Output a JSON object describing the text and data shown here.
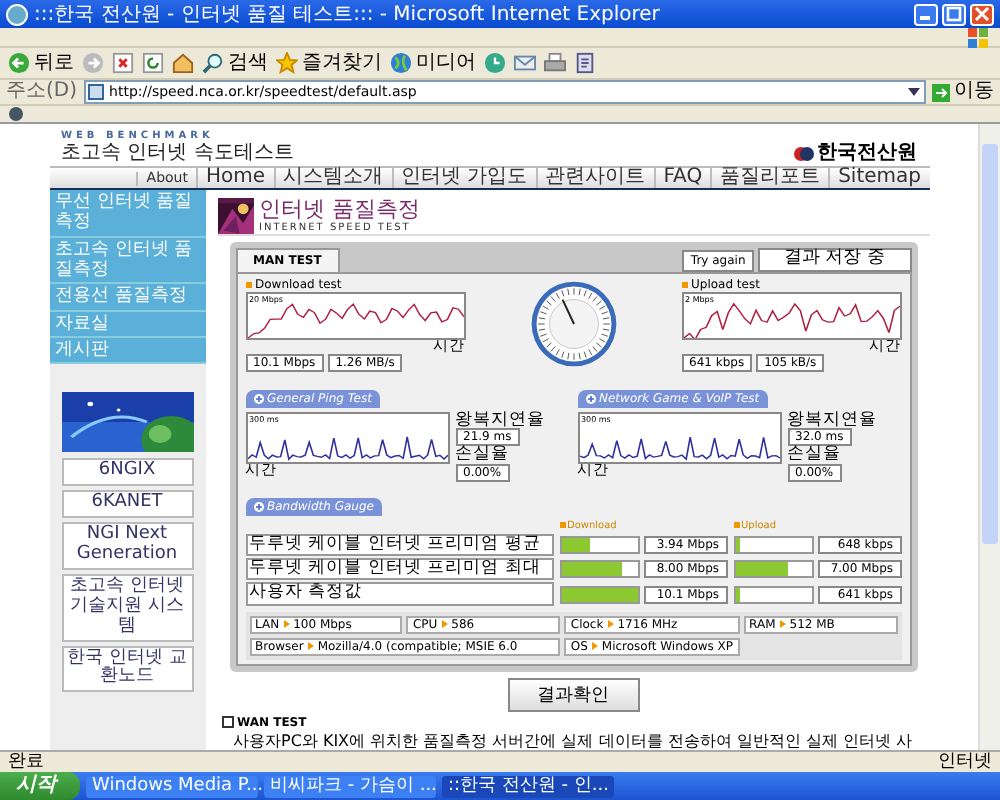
{
  "window": {
    "title": ":::한국 전산원 - 인터넷 품질 테스트::: - Microsoft Internet Explorer"
  },
  "toolbar": [
    {
      "kind": "back",
      "label": "뒤로"
    },
    {
      "kind": "forward"
    },
    {
      "kind": "stop"
    },
    {
      "kind": "refresh"
    },
    {
      "kind": "home"
    },
    {
      "kind": "search",
      "label": "검색"
    },
    {
      "kind": "favorites",
      "label": "즐겨찾기"
    },
    {
      "kind": "media",
      "label": "미디어"
    },
    {
      "kind": "history"
    },
    {
      "kind": "mail"
    },
    {
      "kind": "print"
    },
    {
      "kind": "edit"
    }
  ],
  "address_bar": {
    "label": "주소(D)",
    "url": "http://speed.nca.or.kr/speedtest/default.asp",
    "go": "이동"
  },
  "site": {
    "brand_en": "WEB BENCHMARK",
    "brand": "초고속 인터넷 속도테스트",
    "org": "한국전산원",
    "nav": [
      {
        "label": "About"
      },
      {
        "label": "Home"
      },
      {
        "label": "시스템소개"
      },
      {
        "label": "인터넷 가입도"
      },
      {
        "label": "관련사이트"
      },
      {
        "label": "FAQ"
      },
      {
        "label": "품질리포트"
      },
      {
        "label": "Sitemap"
      }
    ],
    "sidebar_menu": [
      {
        "label": "무선 인터넷 품질측정"
      },
      {
        "label": "초고속 인터넷 품질측정"
      },
      {
        "label": "전용선 품질측정"
      },
      {
        "label": "자료실"
      },
      {
        "label": "게시판"
      }
    ],
    "banners": [
      {
        "kind": "picture"
      },
      {
        "kind": "text",
        "label": "6NGIX"
      },
      {
        "kind": "text",
        "label": "6KANET"
      },
      {
        "kind": "text",
        "label": "NGI Next Generation"
      },
      {
        "kind": "text",
        "label": "초고속 인터넷 기술지원 시스템"
      },
      {
        "kind": "text",
        "label": "한국 인터넷 교환노드"
      }
    ]
  },
  "page": {
    "title": "인터넷 품질측정",
    "subtitle": "INTERNET SPEED TEST"
  },
  "test_panel": {
    "tabs": [
      {
        "label": "MAN TEST",
        "selected": true
      }
    ],
    "try_again": "Try again",
    "status": "결과 저장 중",
    "download": {
      "title": "Download test",
      "scale": "20 Mbps",
      "axis": "시간",
      "values": [
        "10.1 Mbps",
        "1.26 MB/s"
      ]
    },
    "upload": {
      "title": "Upload test",
      "scale": "2 Mbps",
      "axis": "시간",
      "values": [
        "641 kbps",
        "105 kB/s"
      ]
    },
    "ping_tests": [
      {
        "title": "General Ping Test",
        "scale": "300 ms",
        "axis": "시간",
        "latency_label": "왕복지연율",
        "latency": "21.9 ms",
        "loss_label": "손실율",
        "loss": "0.00%"
      },
      {
        "title": "Network Game & VoIP Test",
        "scale": "300 ms",
        "axis": "시간",
        "latency_label": "왕복지연율",
        "latency": "32.0 ms",
        "loss_label": "손실율",
        "loss": "0.00%"
      }
    ],
    "bandwidth": {
      "title": "Bandwidth Gauge",
      "download_label": "Download",
      "upload_label": "Upload",
      "rows": [
        {
          "label": "두루넷 케이블 인터넷 프리미엄 평균",
          "download": {
            "level": 0.39,
            "reading": "3.94 Mbps"
          },
          "upload": {
            "level": 0.06,
            "reading": "648 kbps"
          }
        },
        {
          "label": "두루넷 케이블 인터넷 프리미엄 최대",
          "download": {
            "level": 0.8,
            "reading": "8.00 Mbps"
          },
          "upload": {
            "level": 0.7,
            "reading": "7.00 Mbps"
          }
        },
        {
          "label": "사용자 측정값",
          "download": {
            "level": 1,
            "reading": "10.1 Mbps"
          },
          "upload": {
            "level": 0.06,
            "reading": "641 kbps"
          }
        }
      ]
    },
    "system_info": [
      {
        "label": "LAN",
        "value": "100 Mbps"
      },
      {
        "label": "CPU",
        "value": "586"
      },
      {
        "label": "Clock",
        "value": "1716 MHz"
      },
      {
        "label": "RAM",
        "value": "512 MB"
      },
      {
        "label": "Browser",
        "value": "Mozilla/4.0 (compatible; MSIE 6.0"
      },
      {
        "label": "OS",
        "value": "Microsoft Windows XP"
      }
    ]
  },
  "result_button": "결과확인",
  "wan_test": {
    "title": "WAN TEST",
    "text": "사용자PC와 KIX에 위치한 품질측정 서버간에 실제 데이터를 전송하여 일반적인 실제 인터넷 사"
  },
  "status_bar": {
    "text": "완료",
    "zone": "인터넷"
  },
  "taskbar": {
    "start": "시작",
    "tasks": [
      {
        "label": "Windows Media P...",
        "selected": false
      },
      {
        "label": "비씨파크 - 가슴이 ...",
        "selected": false
      },
      {
        "label": "::한국 전산원 - 인...",
        "selected": true
      }
    ]
  }
}
